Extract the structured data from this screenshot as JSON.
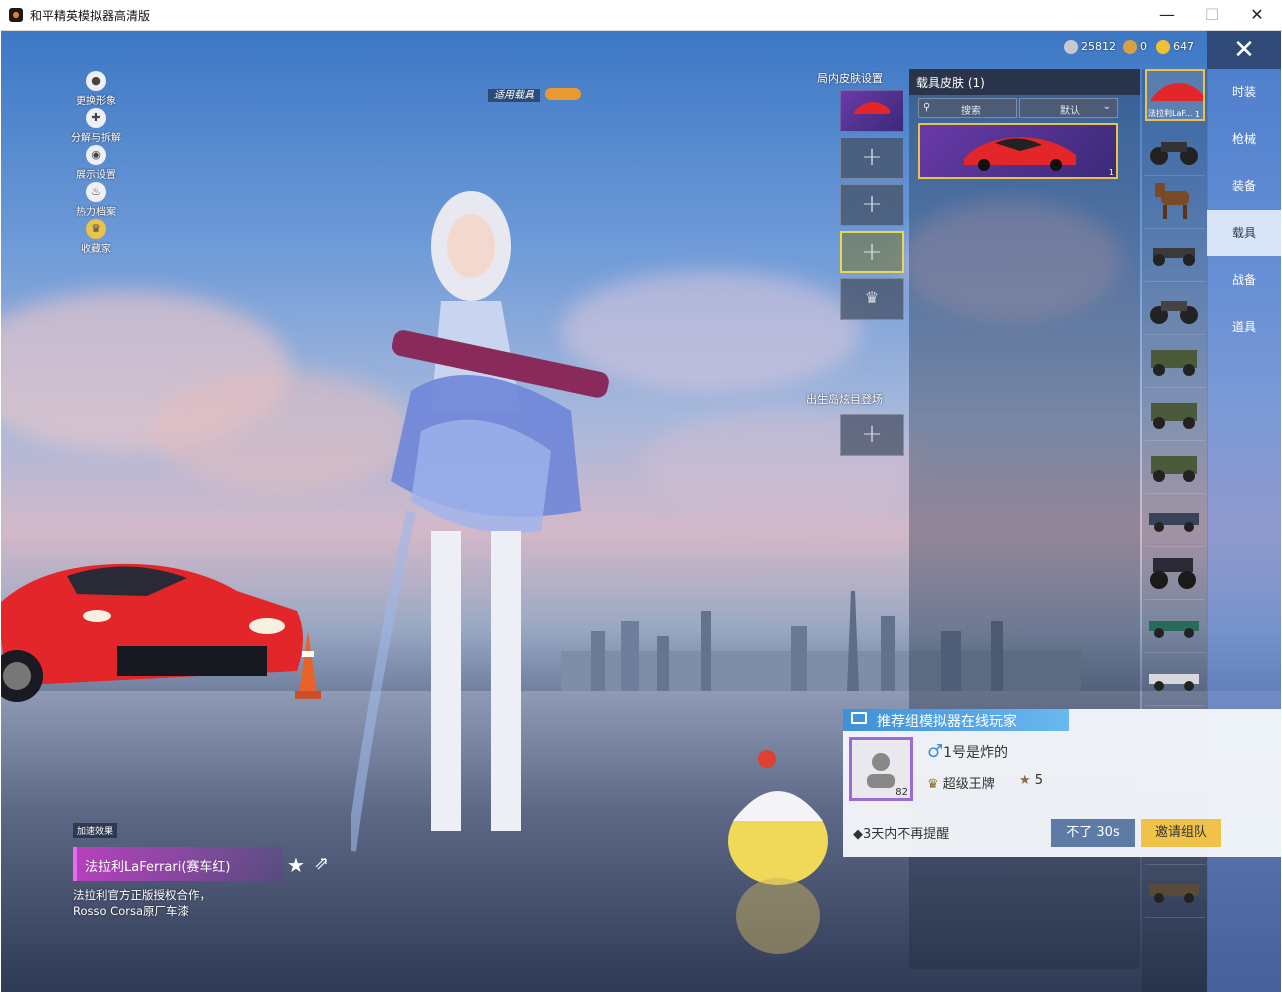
{
  "window": {
    "title": "和平精英模拟器高清版",
    "minimize": "—",
    "maximize": "☐",
    "close": "✕"
  },
  "currency": [
    {
      "icon": "coin-icon",
      "value": "25812",
      "color": "#c8c8d0"
    },
    {
      "icon": "token-icon",
      "value": "0",
      "color": "#d8a040"
    },
    {
      "icon": "gold-icon",
      "value": "647",
      "color": "#f0c030"
    }
  ],
  "left_menu": [
    {
      "icon": "person-icon",
      "label": "更换形象"
    },
    {
      "icon": "puzzle-icon",
      "label": "分解与拆解"
    },
    {
      "icon": "eye-icon",
      "label": "展示设置"
    },
    {
      "icon": "fire-icon",
      "label": "热力档案"
    },
    {
      "icon": "lion-badge-icon",
      "label": "收藏家"
    }
  ],
  "apply_vehicle": "适用载具",
  "slots": {
    "in_game_title": "局内皮肤设置",
    "spawn_title": "出生岛炫目登场",
    "plus": "+",
    "crown": "♛"
  },
  "skin_panel": {
    "title": "载具皮肤 (1)",
    "search": "搜索",
    "sort": "默认",
    "card_count": "1"
  },
  "thumbnails": {
    "active_label": "法拉利LaF...",
    "active_count": "1"
  },
  "categories": [
    "时装",
    "枪械",
    "装备",
    "载具",
    "战备",
    "道具"
  ],
  "active_category": "载具",
  "vehicle_info": {
    "speed_tag": "加速效果",
    "name": "法拉利LaFerrari(赛车红)",
    "description": "法拉利官方正版授权合作，Rosso Corsa原厂车漆"
  },
  "popup": {
    "header": "推荐组模拟器在线玩家",
    "gender": "♂",
    "name": "1号是炸的",
    "level": "82",
    "rank": "超级王牌",
    "stars": "5",
    "remind": "◆3天内不再提醒",
    "no_button": "不了 30s",
    "invite_button": "邀请组队"
  }
}
